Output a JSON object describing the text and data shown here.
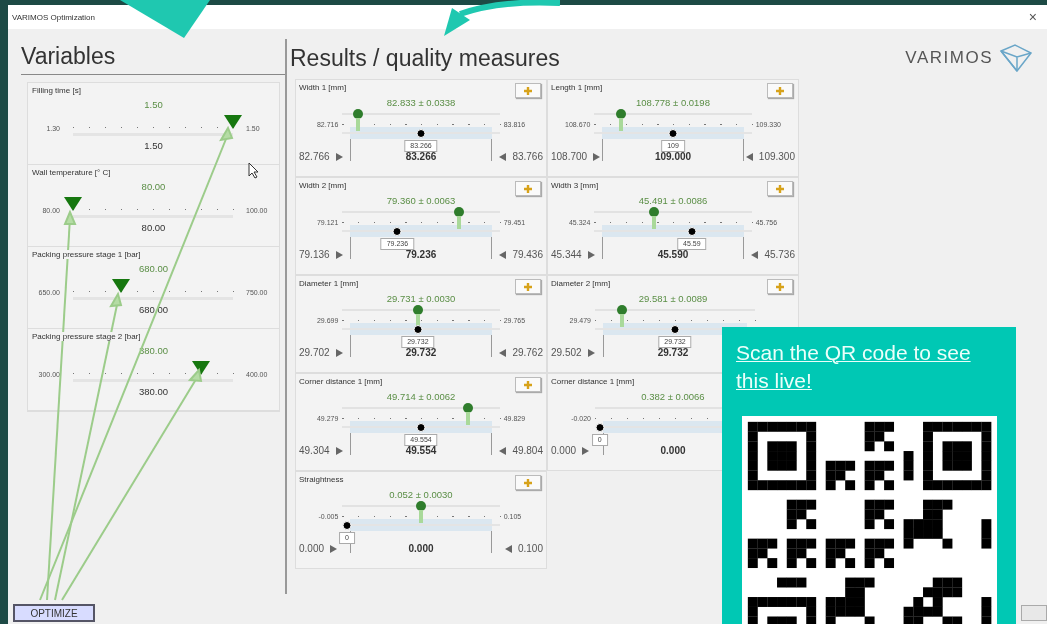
{
  "window": {
    "title": "VARIMOS Optimization",
    "close": "×"
  },
  "variables_panel": {
    "title": "Variables",
    "items": [
      {
        "label": "Filling time [s]",
        "value": "1.50",
        "min": "1.30",
        "max": "1.50",
        "current": "1.50",
        "level": 1.0
      },
      {
        "label": "Wall temperature [°  C]",
        "value": "80.00",
        "min": "80.00",
        "max": "100.00",
        "current": "80.00",
        "level": 0.0
      },
      {
        "label": "Packing pressure stage 1 [bar]",
        "value": "680.00",
        "min": "650.00",
        "max": "750.00",
        "current": "680.00",
        "level": 0.3
      },
      {
        "label": "Packing pressure stage 2 [bar]",
        "value": "380.00",
        "min": "300.00",
        "max": "400.00",
        "current": "380.00",
        "level": 0.8
      }
    ]
  },
  "results_panel": {
    "title": "Results / quality measures",
    "logo": "VARIMOS",
    "columns": [
      [
        {
          "label": "Width 1 [mm]",
          "reading": "82.833  ±  0.0338",
          "scale_min": "82.716",
          "scale_max": "83.816",
          "level": 0.1,
          "target_marker": {
            "level": 0.5
          },
          "target_box": "83.266",
          "lower": "82.766",
          "target": "83.266",
          "upper": "83.766",
          "add_button": true
        },
        {
          "label": "Width 2 [mm]",
          "reading": "79.360  ±  0.0063",
          "scale_min": "79.121",
          "scale_max": "79.451",
          "level": 0.74,
          "target_marker": {
            "level": 0.35
          },
          "target_box": "79.236",
          "lower": "79.136",
          "target": "79.236",
          "upper": "79.436",
          "add_button": true
        },
        {
          "label": "Diameter 1 [mm]",
          "reading": "29.731  ±  0.0030",
          "scale_min": "29.699",
          "scale_max": "29.765",
          "level": 0.48,
          "target_marker": {
            "level": 0.48
          },
          "target_box": "29.732",
          "lower": "29.702",
          "target": "29.732",
          "upper": "29.762",
          "add_button": true
        },
        {
          "label": "Corner distance 1 [mm]",
          "reading": "49.714  ±  0.0062",
          "scale_min": "49.279",
          "scale_max": "49.829",
          "level": 0.8,
          "target_marker": {
            "level": 0.5
          },
          "target_box": "49.554",
          "lower": "49.304",
          "target": "49.554",
          "upper": "49.804",
          "add_button": true
        },
        {
          "label": "Straightness",
          "reading": "0.052  ±  0.0030",
          "scale_min": "-0.005",
          "scale_max": "0.105",
          "level": 0.5,
          "target_marker": {
            "level": 0.03
          },
          "target_box": "0",
          "lower": "0.000",
          "target": "0.000",
          "upper": "0.100",
          "add_button": true
        }
      ],
      [
        {
          "label": "Length 1 [mm]",
          "reading": "108.778  ±  0.0198",
          "scale_min": "108.670",
          "scale_max": "109.330",
          "level": 0.17,
          "target_marker": {
            "level": 0.5
          },
          "target_box": "109",
          "lower": "108.700",
          "target": "109.000",
          "upper": "109.300",
          "add_button": true
        },
        {
          "label": "Width 3 [mm]",
          "reading": "45.491  ±  0.0086",
          "scale_min": "45.324",
          "scale_max": "45.756",
          "level": 0.38,
          "target_marker": {
            "level": 0.62
          },
          "target_box": "45.59",
          "lower": "45.344",
          "target": "45.590",
          "upper": "45.736",
          "add_button": true
        },
        {
          "label": "Diameter 2 [mm]",
          "reading": "29.581  ±  0.0089",
          "scale_min": "29.479",
          "level": 0.17,
          "target_marker": {
            "level": 0.5
          },
          "target_box": "29.732",
          "lower": "29.502",
          "target": "29.732",
          "add_button": true
        },
        {
          "label": "Corner distance 1 [mm]",
          "reading": "0.382  ±  0.0066",
          "scale_min": "-0.020",
          "target_marker": {
            "level": 0.03
          },
          "target_box": "0",
          "lower": "0.000",
          "target": "0.000",
          "add_button": false
        }
      ]
    ]
  },
  "optimize_button": "OPTIMIZE",
  "overlay": {
    "link": "Scan the QR code to see this live!"
  }
}
